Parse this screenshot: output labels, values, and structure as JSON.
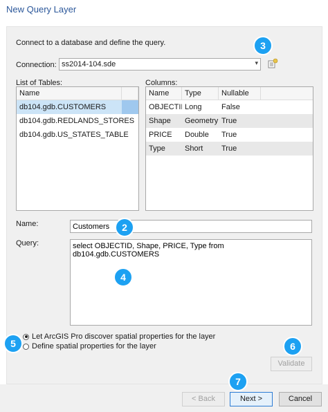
{
  "window": {
    "title": "New Query Layer"
  },
  "intro": "Connect to a database and define the query.",
  "connection": {
    "label": "Connection:",
    "value": "ss2014-104.sde",
    "new_icon": "new-connection-icon"
  },
  "tables": {
    "label": "List of Tables:",
    "header": "Name",
    "items": [
      "db104.gdb.CUSTOMERS",
      "db104.gdb.REDLANDS_STORES",
      "db104.gdb.US_STATES_TABLE"
    ]
  },
  "columns": {
    "label": "Columns:",
    "headers": [
      "Name",
      "Type",
      "Nullable"
    ],
    "rows": [
      [
        "OBJECTID",
        "Long",
        "False"
      ],
      [
        "Shape",
        "Geometry",
        "True"
      ],
      [
        "PRICE",
        "Double",
        "True"
      ],
      [
        "Type",
        "Short",
        "True"
      ]
    ]
  },
  "name": {
    "label": "Name:",
    "value": "Customers"
  },
  "query": {
    "label": "Query:",
    "value": "select OBJECTID, Shape, PRICE, Type from db104.gdb.CUSTOMERS"
  },
  "options": {
    "discover": "Let ArcGIS Pro discover spatial properties for the layer",
    "define": "Define spatial properties for the layer",
    "selected": "discover"
  },
  "buttons": {
    "validate": "Validate",
    "back": "< Back",
    "next": "Next >",
    "cancel": "Cancel"
  },
  "badges": [
    "2",
    "3",
    "4",
    "5",
    "6",
    "7"
  ],
  "accent_color": "#1da1f2"
}
